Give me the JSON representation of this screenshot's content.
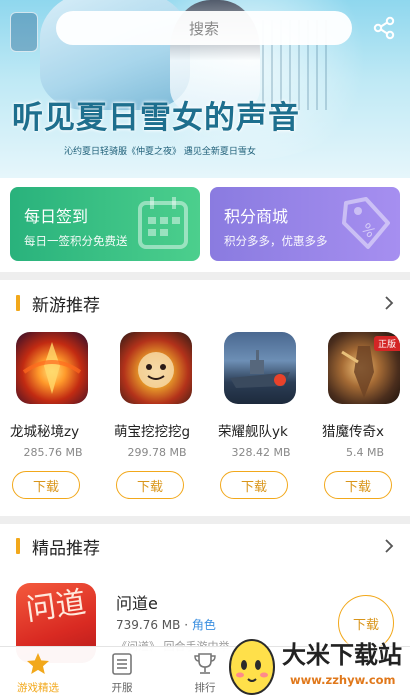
{
  "banner": {
    "headline": "听见夏日雪女的声音",
    "subline": "沁约夏日轻骑服《仲夏之夜》  遇见全新夏日雪女"
  },
  "search": {
    "placeholder": "搜索"
  },
  "cards": [
    {
      "title": "每日签到",
      "subtitle": "每日一签积分免费送",
      "color": "#33bd84",
      "icon": "calendar-icon"
    },
    {
      "title": "积分商城",
      "subtitle": "积分多多，优惠多多",
      "color": "#9684e8",
      "icon": "price-tag-icon"
    }
  ],
  "sections": {
    "new_games": {
      "title": "新游推荐"
    },
    "featured": {
      "title": "精品推荐"
    }
  },
  "new_games": [
    {
      "name": "龙城秘境zy",
      "size": "285.76 MB",
      "download": "下载"
    },
    {
      "name": "萌宝挖挖挖g",
      "size": "299.78 MB",
      "download": "下载"
    },
    {
      "name": "荣耀舰队yk",
      "size": "328.42 MB",
      "download": "下载"
    },
    {
      "name": "猎魔传奇x",
      "size": "5.4 MB",
      "download": "下载",
      "badge": "正版"
    }
  ],
  "featured_item": {
    "name": "问道e",
    "size": "739.76 MB",
    "separator": "·",
    "tag": "角色",
    "description": "《问道》 回合手游中举",
    "download": "下载",
    "icon_text": "问道"
  },
  "nav": [
    {
      "label": "游戏精选",
      "icon": "star-icon",
      "active": true
    },
    {
      "label": "开服",
      "icon": "list-icon",
      "active": false
    },
    {
      "label": "排行",
      "icon": "trophy-icon",
      "active": false
    }
  ],
  "watermark": {
    "title": "大米下载站",
    "url": "www.zzhyw.com"
  },
  "colors": {
    "accent": "#f2a81b",
    "link": "#3b8fe0"
  }
}
